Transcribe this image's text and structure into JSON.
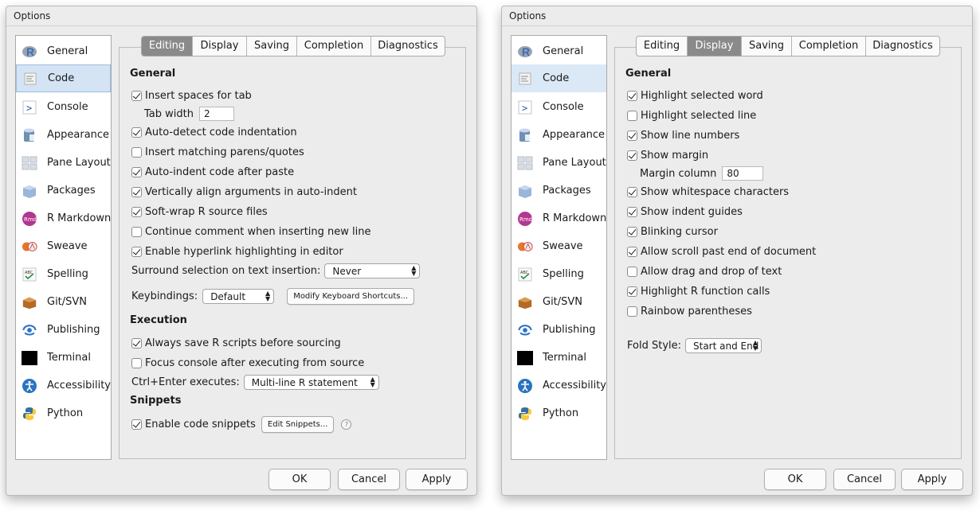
{
  "left_dialog": {
    "title": "Options",
    "sidebar": [
      {
        "label": "General",
        "icon": "r-logo-icon"
      },
      {
        "label": "Code",
        "icon": "code-icon"
      },
      {
        "label": "Console",
        "icon": "console-icon"
      },
      {
        "label": "Appearance",
        "icon": "appearance-icon"
      },
      {
        "label": "Pane Layout",
        "icon": "pane-layout-icon"
      },
      {
        "label": "Packages",
        "icon": "packages-icon"
      },
      {
        "label": "R Markdown",
        "icon": "rmd-icon"
      },
      {
        "label": "Sweave",
        "icon": "sweave-icon"
      },
      {
        "label": "Spelling",
        "icon": "spelling-icon"
      },
      {
        "label": "Git/SVN",
        "icon": "git-icon"
      },
      {
        "label": "Publishing",
        "icon": "publishing-icon"
      },
      {
        "label": "Terminal",
        "icon": "terminal-icon"
      },
      {
        "label": "Accessibility",
        "icon": "accessibility-icon"
      },
      {
        "label": "Python",
        "icon": "python-icon"
      }
    ],
    "selected_item": "Code",
    "tabs": [
      "Editing",
      "Display",
      "Saving",
      "Completion",
      "Diagnostics"
    ],
    "active_tab": "Editing",
    "general_heading": "General",
    "insert_spaces": {
      "label": "Insert spaces for tab",
      "checked": true
    },
    "tab_width": {
      "label": "Tab width",
      "value": "2"
    },
    "auto_detect": {
      "label": "Auto-detect code indentation",
      "checked": true
    },
    "matching_parens": {
      "label": "Insert matching parens/quotes",
      "checked": false
    },
    "auto_indent": {
      "label": "Auto-indent code after paste",
      "checked": true
    },
    "vertical_align": {
      "label": "Vertically align arguments in auto-indent",
      "checked": true
    },
    "soft_wrap": {
      "label": "Soft-wrap R source files",
      "checked": true
    },
    "continue_comment": {
      "label": "Continue comment when inserting new line",
      "checked": false
    },
    "hyperlink": {
      "label": "Enable hyperlink highlighting in editor",
      "checked": true
    },
    "surround": {
      "label": "Surround selection on text insertion:",
      "value": "Never"
    },
    "keybindings": {
      "label": "Keybindings:",
      "value": "Default",
      "modify_label": "Modify Keyboard Shortcuts..."
    },
    "execution_heading": "Execution",
    "always_save": {
      "label": "Always save R scripts before sourcing",
      "checked": true
    },
    "focus_console": {
      "label": "Focus console after executing from source",
      "checked": false
    },
    "ctrl_enter": {
      "label": "Ctrl+Enter executes:",
      "value": "Multi-line R statement"
    },
    "snippets_heading": "Snippets",
    "enable_snippets": {
      "label": "Enable code snippets",
      "checked": true
    },
    "edit_snippets_label": "Edit Snippets...",
    "help_label": "?",
    "ok_label": "OK",
    "cancel_label": "Cancel",
    "apply_label": "Apply"
  },
  "right_dialog": {
    "title": "Options",
    "selected_item": "Code",
    "tabs": [
      "Editing",
      "Display",
      "Saving",
      "Completion",
      "Diagnostics"
    ],
    "active_tab": "Display",
    "general_heading": "General",
    "highlight_word": {
      "label": "Highlight selected word",
      "checked": true
    },
    "highlight_line": {
      "label": "Highlight selected line",
      "checked": false
    },
    "line_numbers": {
      "label": "Show line numbers",
      "checked": true
    },
    "show_margin": {
      "label": "Show margin",
      "checked": true
    },
    "margin_column": {
      "label": "Margin column",
      "value": "80"
    },
    "whitespace": {
      "label": "Show whitespace characters",
      "checked": true
    },
    "indent_guides": {
      "label": "Show indent guides",
      "checked": true
    },
    "blinking": {
      "label": "Blinking cursor",
      "checked": true
    },
    "scroll_past": {
      "label": "Allow scroll past end of document",
      "checked": true
    },
    "drag_drop": {
      "label": "Allow drag and drop of text",
      "checked": false
    },
    "highlight_r": {
      "label": "Highlight R function calls",
      "checked": true
    },
    "rainbow": {
      "label": "Rainbow parentheses",
      "checked": false
    },
    "fold_style": {
      "label": "Fold Style:",
      "value": "Start and End"
    },
    "ok_label": "OK",
    "cancel_label": "Cancel",
    "apply_label": "Apply"
  },
  "colors": {
    "selection": "#d4e4f5",
    "active_tab": "#8a8a8a",
    "dialog_bg": "#ececec"
  }
}
